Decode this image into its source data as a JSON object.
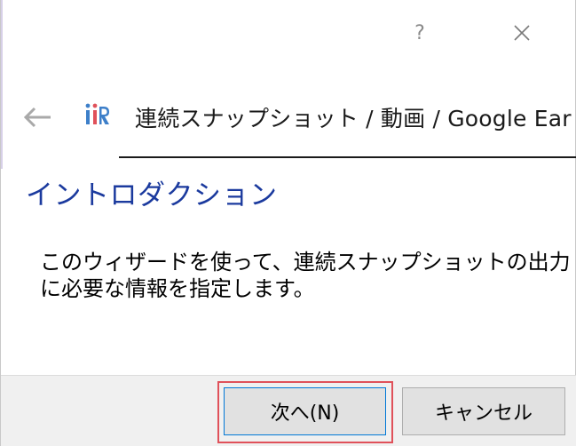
{
  "titlebar": {
    "help_label": "?",
    "close_label": "✕"
  },
  "header": {
    "back_icon": "back-arrow-icon",
    "logo_icon": "iric-logo-icon",
    "title": "連続スナップショット / 動画 / Google Ear"
  },
  "content": {
    "heading": "イントロダクション",
    "line1": "このウィザードを使って、連続スナップショットの出力",
    "line2": "に必要な情報を指定します。"
  },
  "footer": {
    "next_label": "次へ(N)",
    "cancel_label": "キャンセル"
  },
  "colors": {
    "heading": "#1b3a9e",
    "highlight": "#e0515a",
    "logo_blue": "#3d7fc9",
    "logo_red": "#e0515a"
  }
}
